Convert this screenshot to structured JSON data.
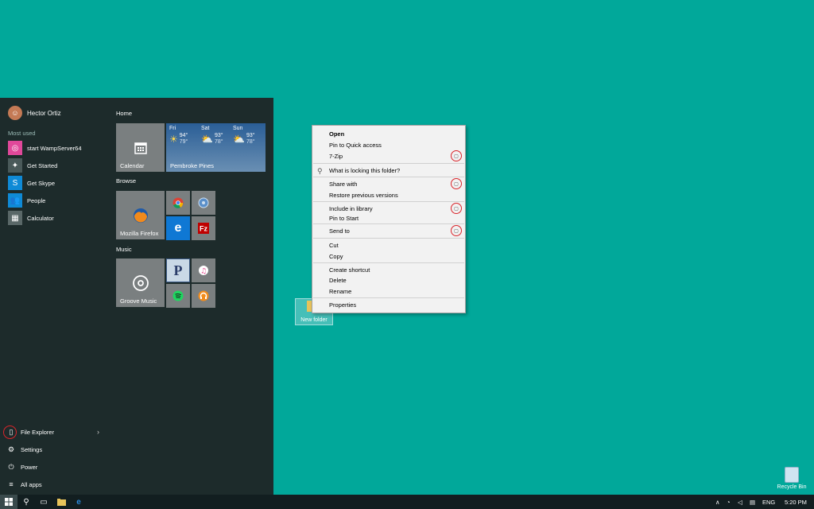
{
  "start_menu": {
    "user_name": "Hector Ortiz",
    "most_used_label": "Most used",
    "most_used": [
      {
        "label": "start WampServer64",
        "icon": "wampserver-icon",
        "color": "#e0489a"
      },
      {
        "label": "Get Started",
        "icon": "lightbulb-icon",
        "color": "#4a5a5a"
      },
      {
        "label": "Get Skype",
        "icon": "skype-icon",
        "color": "#0f8ad6"
      },
      {
        "label": "People",
        "icon": "people-icon",
        "color": "#0f8ad6"
      },
      {
        "label": "Calculator",
        "icon": "calculator-icon",
        "color": "#5a6868"
      }
    ],
    "bottom": {
      "file_explorer": "File Explorer",
      "settings": "Settings",
      "power": "Power",
      "all_apps": "All apps"
    }
  },
  "tiles": {
    "home_label": "Home",
    "browse_label": "Browse",
    "music_label": "Music",
    "calendar": "Calendar",
    "firefox": "Mozilla Firefox",
    "groove": "Groove Music",
    "weather": {
      "location": "Pembroke Pines",
      "days": [
        {
          "day": "Fri",
          "high": "94°",
          "low": "79°"
        },
        {
          "day": "Sat",
          "high": "93°",
          "low": "78°"
        },
        {
          "day": "Sun",
          "high": "93°",
          "low": "78°"
        }
      ]
    },
    "p_tile_letter": "P"
  },
  "context_menu": {
    "open": "Open",
    "pin_quick": "Pin to Quick access",
    "seven_zip": "7-Zip",
    "locking": "What is locking this folder?",
    "share_with": "Share with",
    "restore": "Restore previous versions",
    "include_library": "Include in library",
    "pin_start": "Pin to Start",
    "send_to": "Send to",
    "cut": "Cut",
    "copy": "Copy",
    "create_shortcut": "Create shortcut",
    "delete": "Delete",
    "rename": "Rename",
    "properties": "Properties"
  },
  "desktop": {
    "new_folder": "New folder",
    "recycle_bin": "Recycle Bin"
  },
  "taskbar": {
    "language": "ENG",
    "time": "5:20 PM"
  },
  "colors": {
    "desktop": "#01a89a",
    "start_bg": "#1d2b2b",
    "tile_gray": "#7a7f80",
    "tile_blue": "#0f78d4",
    "highlight_ring": "#d9252b"
  }
}
